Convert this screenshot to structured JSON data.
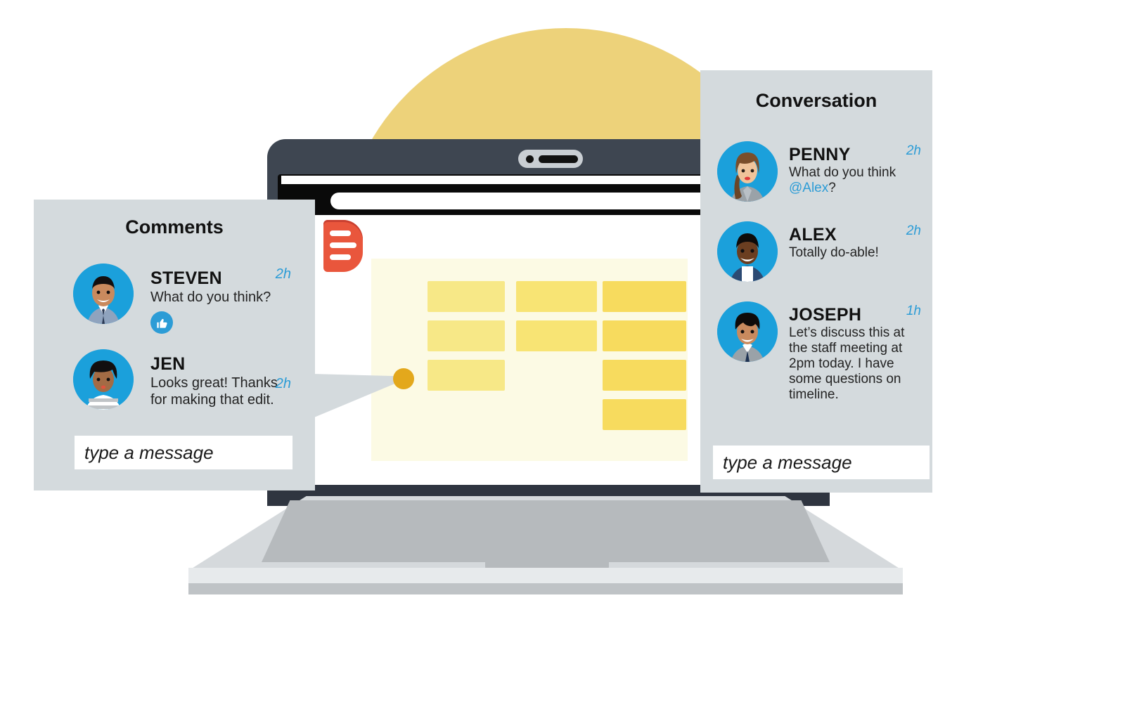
{
  "theme": {
    "panel_bg": "#D4DADD",
    "accent_blue": "#2C9CD6",
    "avatar_blue": "#1BA0DB",
    "circle_yellow": "#EDD27A",
    "doc_yellow": "#FCFAE4",
    "marker_red": "#E9563C",
    "anchor_gold": "#E3A81C",
    "laptop_dark": "#3E4651"
  },
  "comments_panel": {
    "title": "Comments",
    "messages": [
      {
        "name": "STEVEN",
        "text": "What do you think?",
        "time": "2h",
        "avatar": "avatar-steven",
        "reaction": "thumbs-up-icon"
      },
      {
        "name": "JEN",
        "text": "Looks great! Thanks for making that edit.",
        "time": "2h",
        "avatar": "avatar-jen"
      }
    ],
    "composer": {
      "placeholder": "type a message",
      "value": ""
    }
  },
  "conversation_panel": {
    "title": "Conversation",
    "messages": [
      {
        "name": "PENNY",
        "text_before": "What do you think ",
        "mention": "@Alex",
        "text_after": "?",
        "time": "2h",
        "avatar": "avatar-penny"
      },
      {
        "name": "ALEX",
        "text": "Totally do-able!",
        "time": "2h",
        "avatar": "avatar-alex"
      },
      {
        "name": "JOSEPH",
        "text": "Let’s discuss this at the staff meeting at 2pm today. I have some questions on timeline.",
        "time": "1h",
        "avatar": "avatar-joseph"
      }
    ],
    "composer": {
      "placeholder": "type a message",
      "value": ""
    }
  },
  "laptop": {
    "camera": "webcam-icon",
    "speaker": "speaker-bar",
    "url_bar_value": "",
    "document": {
      "comment_marker": "comment-marker-icon",
      "anchor": "comment-anchor-dot",
      "table": {
        "columns": [
          {
            "shade": "light",
            "cells": 3
          },
          {
            "shade": "medium",
            "cells": 2
          },
          {
            "shade": "dark",
            "cells": 4
          }
        ]
      }
    }
  }
}
